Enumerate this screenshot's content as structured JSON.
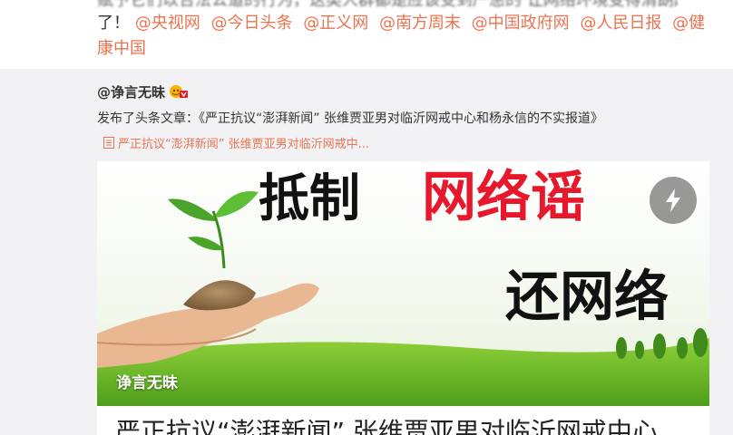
{
  "top_post": {
    "text_partial": "赋予它们以合法公道的行为，这类人群都是应该受到严惩的 让网络环境变得清朗起来",
    "text_end": "了！",
    "mentions": [
      "@央视网",
      "@今日头条",
      "@正义网",
      "@南方周末",
      "@中国政府网",
      "@人民日报",
      "@健康中国"
    ]
  },
  "repost": {
    "author": "@诤言无昧",
    "description": "发布了头条文章：《严正抗议“澎湃新闻” 张维贾亚男对临沂网戒中心和杨永信的不实报道》",
    "article_link": "严正抗议“澎湃新闻” 张维贾亚男对临沂网戒中...",
    "card": {
      "banner_line1_black": "抵制",
      "banner_line1_red": "网络谣",
      "banner_line2": "还网络",
      "watermark": "诤言无昧",
      "title": "严正抗议“澎湃新闻” 张维贾亚男对临沂网戒中心"
    }
  },
  "colors": {
    "mention": "#eb7350",
    "background": "#f2f2f5",
    "banner_red": "#e8182c"
  },
  "icons": {
    "vip": "vip-badge-icon",
    "article": "document-icon",
    "flash": "lightning-icon"
  }
}
